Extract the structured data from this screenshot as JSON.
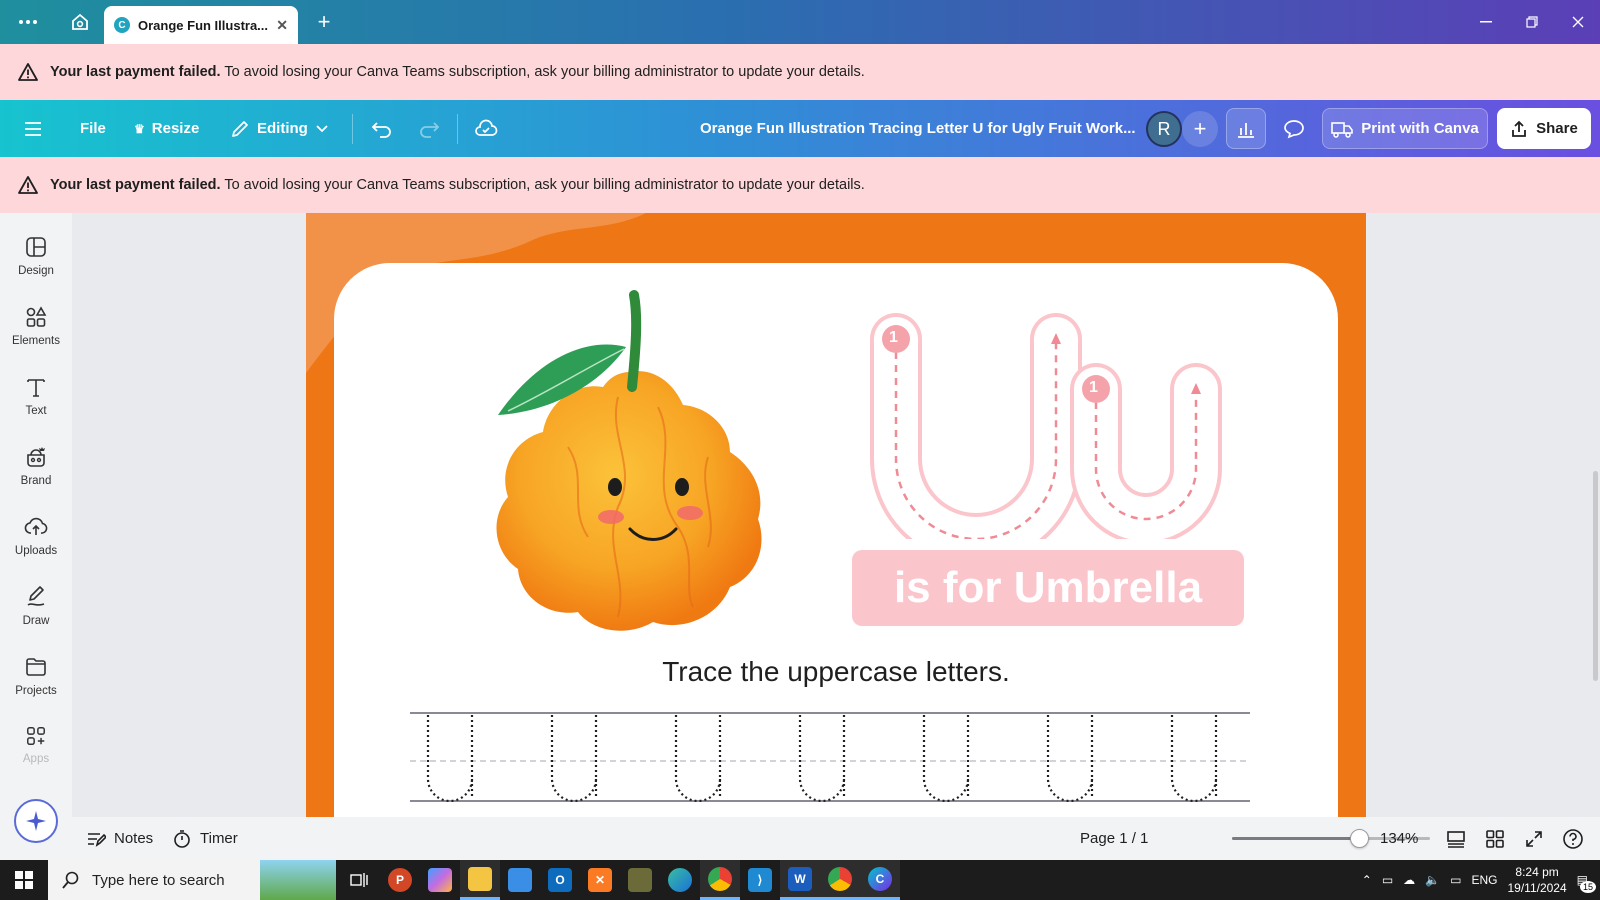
{
  "browser": {
    "tab_title": "Orange Fun Illustra...",
    "icons": [
      "more-icon",
      "home-icon",
      "new-tab-icon",
      "minimize-icon",
      "restore-icon",
      "close-icon"
    ]
  },
  "alert": {
    "bold": "Your last payment failed.",
    "text": " To avoid losing your Canva Teams subscription, ask your billing administrator to update your details."
  },
  "toolbar": {
    "file": "File",
    "resize": "Resize",
    "editing": "Editing",
    "doc_title": "Orange Fun Illustration Tracing Letter U for Ugly Fruit Work...",
    "avatar_initial": "R",
    "print": "Print with Canva",
    "share": "Share"
  },
  "sidebar": {
    "items": [
      {
        "label": "Design",
        "icon": "design-icon"
      },
      {
        "label": "Elements",
        "icon": "elements-icon"
      },
      {
        "label": "Text",
        "icon": "text-icon"
      },
      {
        "label": "Brand",
        "icon": "brand-icon"
      },
      {
        "label": "Uploads",
        "icon": "uploads-icon"
      },
      {
        "label": "Draw",
        "icon": "draw-icon"
      },
      {
        "label": "Projects",
        "icon": "projects-icon"
      },
      {
        "label": "Apps",
        "icon": "apps-icon"
      }
    ]
  },
  "worksheet": {
    "letters": "Uu",
    "stroke_number": "1",
    "subtitle": "is for Umbrella",
    "instruction": "Trace the uppercase letters.",
    "trace_count": 7,
    "colors": {
      "background": "#ef7614",
      "pink": "#fbc5cc",
      "pink_dark": "#f08a94"
    }
  },
  "footer": {
    "notes": "Notes",
    "timer": "Timer",
    "page_indicator": "Page 1 / 1",
    "zoom": "134%",
    "zoom_level": 0.64
  },
  "taskbar": {
    "search_placeholder": "Type here to search",
    "language": "ENG",
    "time": "8:24 pm",
    "date": "19/11/2024",
    "notifications": "15",
    "apps": [
      "task-view-icon",
      "ppt-app-icon",
      "copilot-app-icon",
      "file-explorer-icon",
      "store-app-icon",
      "outlook-app-icon",
      "xampp-app-icon",
      "game-app-icon",
      "edge-app-icon",
      "chrome-app-icon",
      "vscode-app-icon",
      "word-app-icon",
      "chrome-profile-app-icon",
      "canva-app-icon"
    ]
  }
}
